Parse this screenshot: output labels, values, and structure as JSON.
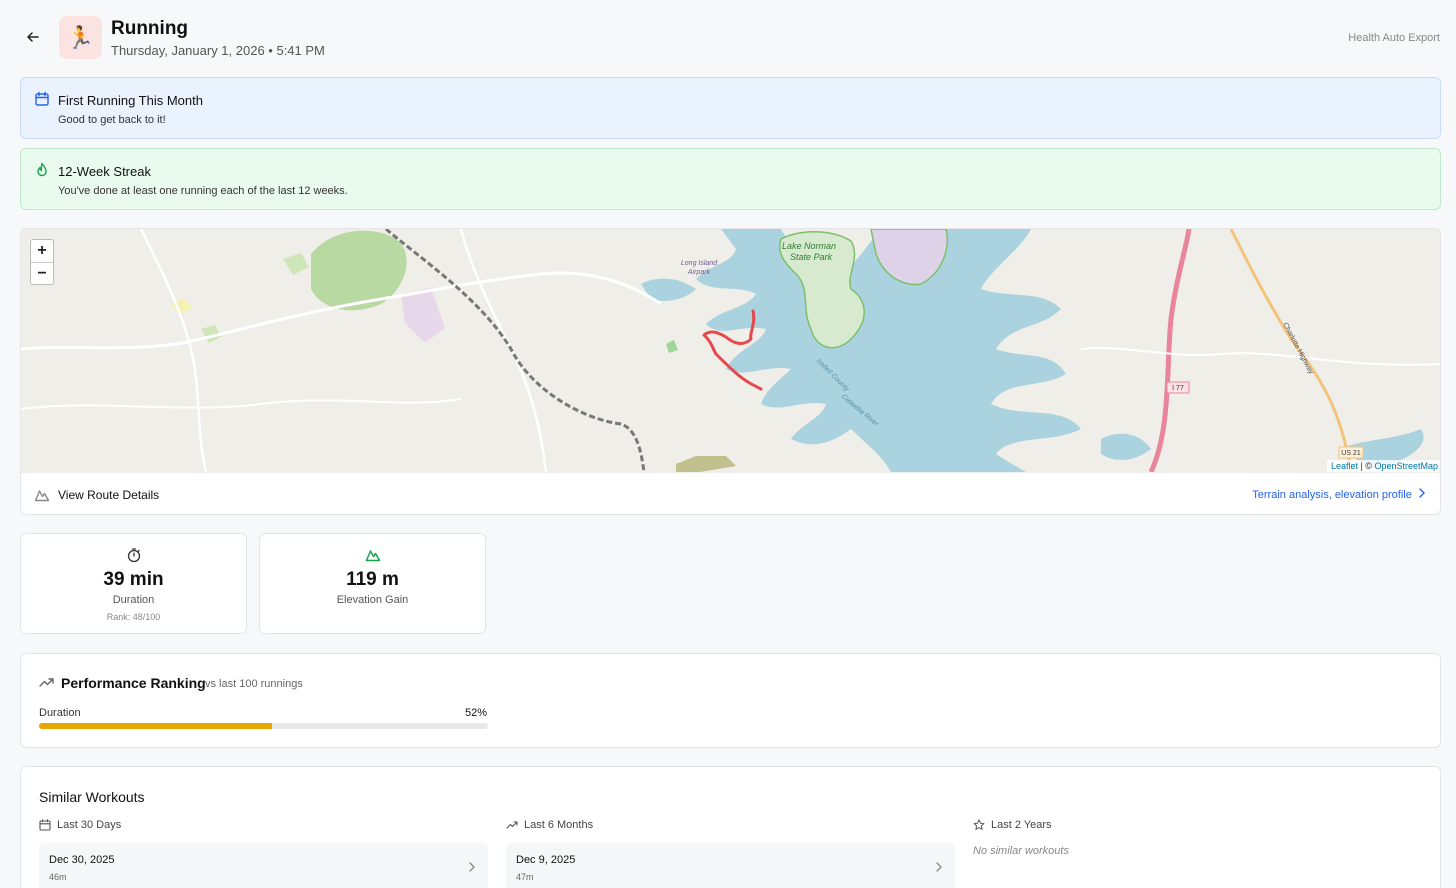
{
  "header": {
    "title": "Running",
    "subtitle": "Thursday, January 1, 2026 • 5:41 PM",
    "source": "Health Auto Export",
    "activity_icon": "runner-emoji"
  },
  "banners": [
    {
      "title": "First Running This Month",
      "text": "Good to get back to it!",
      "icon": "calendar-icon"
    },
    {
      "title": "12-Week Streak",
      "text": "You've done at least one running each of the last 12 weeks.",
      "icon": "flame-icon"
    }
  ],
  "map": {
    "zoom_in": "+",
    "zoom_out": "−",
    "place_labels": [
      "Lake Norman State Park",
      "Long Island Airpark",
      "I 77",
      "US 21",
      "Charlotte Highway",
      "Iredell County",
      "Catawba River"
    ],
    "attribution_leaflet": "Leaflet",
    "attribution_sep": " | © ",
    "attribution_osm": "OpenStreetMap",
    "route_color": "#e5484d"
  },
  "route_row": {
    "label": "View Route Details",
    "link": "Terrain analysis, elevation profile"
  },
  "stats": [
    {
      "value": "39 min",
      "label": "Duration",
      "rank": "Rank: 48/100",
      "icon": "stopwatch-icon"
    },
    {
      "value": "119 m",
      "label": "Elevation Gain",
      "rank": "",
      "icon": "mountain-icon"
    }
  ],
  "performance": {
    "title": "Performance Ranking",
    "subtitle": "vs last 100 runnings",
    "metric_label": "Duration",
    "metric_pct_text": "52%",
    "metric_fraction": 0.52,
    "bar_color": "#e6a800"
  },
  "similar": {
    "title": "Similar Workouts",
    "columns": [
      {
        "heading": "Last 30 Days",
        "icon": "calendar-icon",
        "date": "Dec 30, 2025",
        "duration": "46m",
        "empty": ""
      },
      {
        "heading": "Last 6 Months",
        "icon": "trend-icon",
        "date": "Dec 9, 2025",
        "duration": "47m",
        "empty": ""
      },
      {
        "heading": "Last 2 Years",
        "icon": "star-icon",
        "date": "",
        "duration": "",
        "empty": "No similar workouts"
      }
    ]
  }
}
